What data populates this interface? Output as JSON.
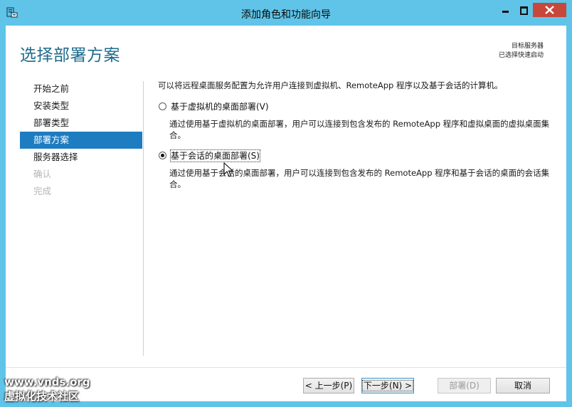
{
  "window": {
    "title": "添加角色和功能向导",
    "accent": "#5fc4e8",
    "close_color": "#c7473a"
  },
  "page": {
    "title": "选择部署方案",
    "destination_label": "目标服务器",
    "destination_value": "已选择快速启动"
  },
  "nav": {
    "items": [
      {
        "label": "开始之前",
        "state": "normal"
      },
      {
        "label": "安装类型",
        "state": "normal"
      },
      {
        "label": "部署类型",
        "state": "normal"
      },
      {
        "label": "部署方案",
        "state": "selected"
      },
      {
        "label": "服务器选择",
        "state": "normal"
      },
      {
        "label": "确认",
        "state": "disabled"
      },
      {
        "label": "完成",
        "state": "disabled"
      }
    ],
    "selected_color": "#1e7cc0"
  },
  "main": {
    "intro": "可以将远程桌面服务配置为允许用户连接到虚拟机、RemoteApp 程序以及基于会话的计算机。",
    "options": [
      {
        "label": "基于虚拟机的桌面部署(V)",
        "description": "通过使用基于虚拟机的桌面部署，用户可以连接到包含发布的 RemoteApp 程序和虚拟桌面的虚拟桌面集合。",
        "checked": false
      },
      {
        "label": "基于会话的桌面部署(S)",
        "description": "通过使用基于会话的桌面部署，用户可以连接到包含发布的 RemoteApp 程序和基于会话的桌面的会话集合。",
        "checked": true
      }
    ]
  },
  "buttons": {
    "prev": "< 上一步(P)",
    "next": "下一步(N) >",
    "deploy": "部署(D)",
    "cancel": "取消"
  },
  "watermark": {
    "line1": "www.vnds.org",
    "line2": "虚拟化技术社区"
  }
}
